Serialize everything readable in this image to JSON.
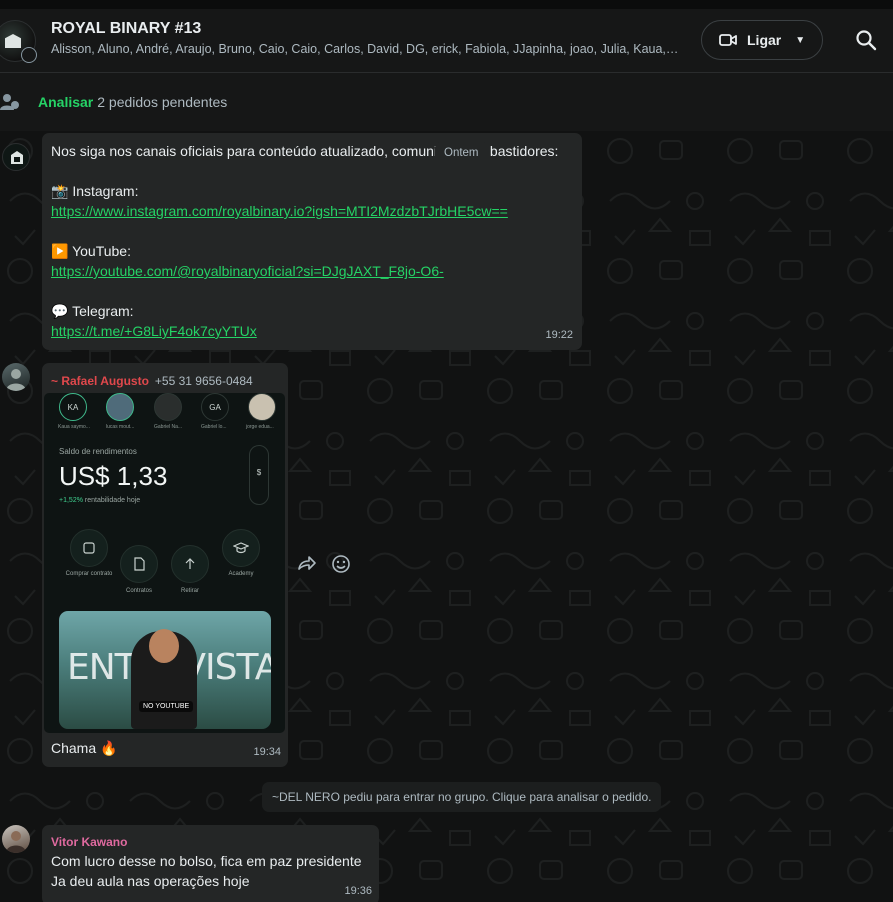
{
  "header": {
    "title": "ROYAL BINARY #13",
    "members": "Alisson, Aluno, André, Araujo, Bruno, Caio, Caio, Carlos, David, DG, erick, Fabiola, JJapinha, joao, Julia, Kaua, Kaua, Lucas, Marcos, Nero, Rafael, Vitor",
    "call_label": "Ligar",
    "icons": {
      "avatar": "group-avatar",
      "call": "video-camera-icon",
      "caret": "chevron-down-icon",
      "search": "search-icon"
    }
  },
  "pending": {
    "link": "Analisar",
    "text": "2 pedidos pendentes"
  },
  "chat": {
    "date_pill": "Ontem",
    "messages": [
      {
        "intro": "Nos siga nos canais oficiais para conteúdo atualizado, comunicados e bastidores:",
        "instagram_label": "📸 Instagram:",
        "instagram_url": "https://www.instagram.com/royalbinary.io?igsh=MTI2MzdzbTJrbHE5cw==",
        "youtube_label": "▶️ YouTube:",
        "youtube_url": "https://youtube.com/@royalbinaryoficial?si=DJgJAXT_F8jo-O6-",
        "telegram_label": "💬 Telegram:",
        "telegram_url": "https://t.me/+G8LiyF4ok7cyYTUx",
        "time": "19:22"
      },
      {
        "sender": "~ Rafael Augusto",
        "phone": "+55 31 9656-0484",
        "sender_color": "#e0484c",
        "image": {
          "stories": [
            {
              "initials": "KA",
              "caption": "Kaua saymo..."
            },
            {
              "initials": "",
              "caption": "lucas mout..."
            },
            {
              "initials": "",
              "caption": "Gabriel Na..."
            },
            {
              "initials": "GA",
              "caption": "Gabriel lo..."
            },
            {
              "initials": "",
              "caption": "jorge edua..."
            }
          ],
          "balance_label": "Saldo de rendimentos",
          "balance": "US$ 1,33",
          "growth": "+1,52%",
          "growth_suffix": "rentabilidade hoje",
          "toggle": "$",
          "actions": [
            "Comprar contrato",
            "Contratos",
            "Retirar",
            "Academy"
          ],
          "banner_word": "ENTREVISTA",
          "banner_tag": "NO YOUTUBE"
        },
        "caption": "Chama 🔥",
        "time": "19:34"
      },
      {
        "system": "~DEL NERO pediu para entrar no grupo. Clique para analisar o pedido."
      },
      {
        "sender": "Vitor Kawano",
        "sender_color": "#e06aa0",
        "line1": "Com lucro desse no bolso, fica em paz presidente",
        "line2": "Ja deu aula nas operações hoje",
        "time": "19:36"
      }
    ]
  },
  "colors": {
    "accent_green": "#25d366",
    "bubble": "#242626",
    "background": "#111212"
  }
}
